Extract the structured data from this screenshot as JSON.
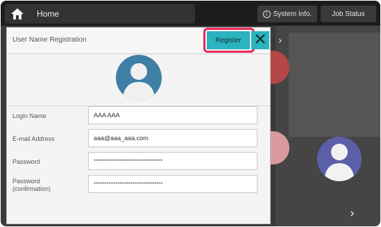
{
  "topbar": {
    "home_label": "Home",
    "system_info_label": "System Info.",
    "job_status_label": "Job Status"
  },
  "dialog": {
    "title": "User Name Registration",
    "register_label": "Register",
    "fields": [
      {
        "label": "Login Name",
        "value": "AAA AAA"
      },
      {
        "label": "E-mail Address",
        "value": "aaa@aaa_aaa.com"
      },
      {
        "label": "Password",
        "value": "********************************"
      },
      {
        "label": "Password\n(confirmation)",
        "value": "********************************"
      }
    ]
  },
  "colors": {
    "accent": "#2bb3bf",
    "highlight": "#e8285a",
    "avatar": "#3e7fa5"
  }
}
